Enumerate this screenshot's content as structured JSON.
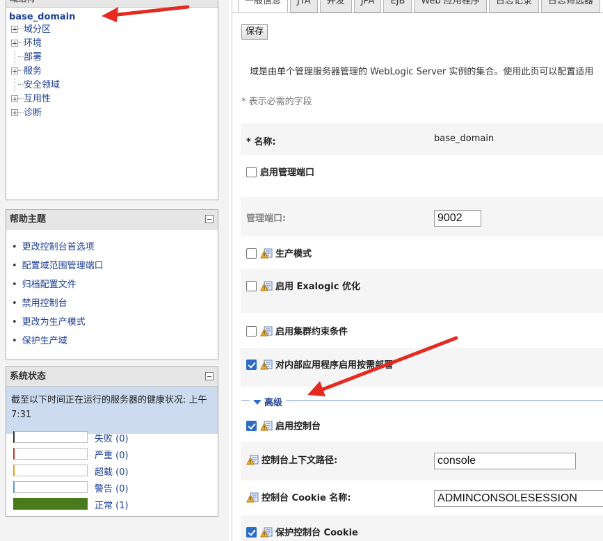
{
  "tree": {
    "header": "域结构",
    "root": "base_domain",
    "items": [
      "域分区",
      "环境",
      "部署",
      "服务",
      "安全领域",
      "互用性",
      "诊断"
    ]
  },
  "help": {
    "title": "帮助主题",
    "links": [
      "更改控制台首选项",
      "配置域范围管理端口",
      "归档配置文件",
      "禁用控制台",
      "更改为生产模式",
      "保护生产域"
    ]
  },
  "system_status": {
    "title": "系统状态",
    "description": "截至以下时间正在运行的服务器的健康状况: 上午7:31",
    "rows": [
      {
        "label": "失败 (0)",
        "color": "#333333",
        "fill": 0
      },
      {
        "label": "严重 (0)",
        "color": "#c0392b",
        "fill": 0
      },
      {
        "label": "超载 (0)",
        "color": "#e0a020",
        "fill": 0
      },
      {
        "label": "警告 (0)",
        "color": "#5b9bd5",
        "fill": 0
      },
      {
        "label": "正常 (1)",
        "color": "#4a7a1e",
        "fill": 1
      }
    ]
  },
  "tabs": [
    "一般信息",
    "JTA",
    "并发",
    "JPA",
    "EJB",
    "Web 应用程序",
    "日志记录",
    "日志筛选器"
  ],
  "toolbar": {
    "save_label": "保存"
  },
  "intro": "域是由单个管理服务器管理的 WebLogic Server 实例的集合。使用此页可以配置适用",
  "required_note": "* 表示必需的字段",
  "form": {
    "name_label": "* 名称:",
    "name_value": "base_domain",
    "enable_admin_port": "启用管理端口",
    "admin_port_label": "管理端口:",
    "admin_port_value": "9002",
    "production_mode": "生产模式",
    "exalogic": "启用 Exalogic 优化",
    "cluster_constraints": "启用集群约束条件",
    "internal_apps": "对内部应用程序启用按需部署",
    "advanced": "高级",
    "enable_console": "启用控制台",
    "console_context_label": "控制台上下文路径:",
    "console_context_value": "console",
    "console_cookie_label": "控制台 Cookie 名称:",
    "console_cookie_value": "ADMINCONSOLESESSION",
    "protect_cookie": "保护控制台 Cookie"
  }
}
